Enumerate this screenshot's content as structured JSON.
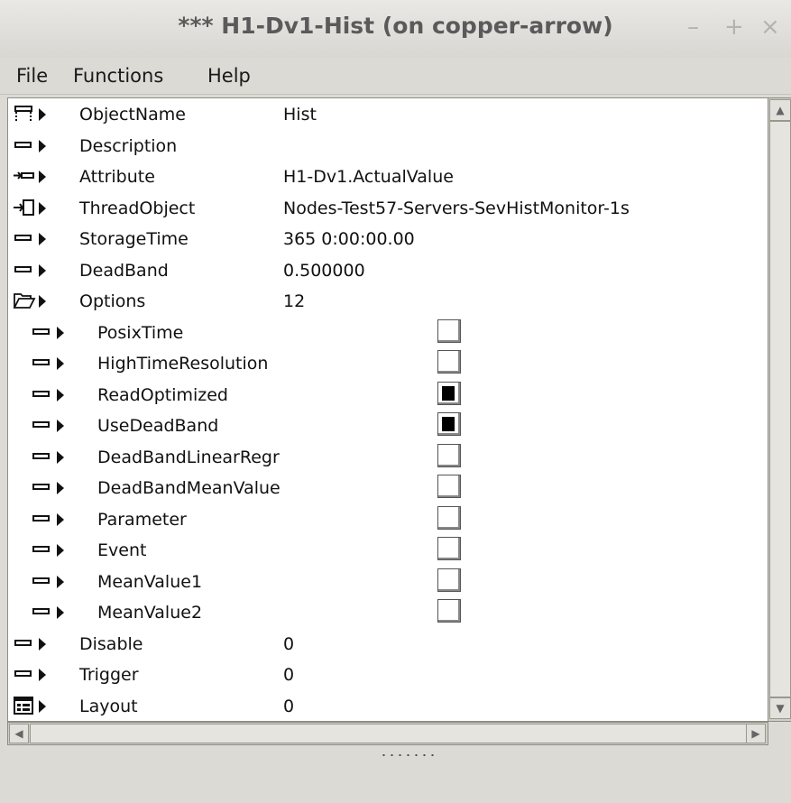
{
  "window": {
    "title": "*** H1-Dv1-Hist (on copper-arrow)",
    "minimize": "–",
    "maximize": "+",
    "close": "×"
  },
  "menu": [
    "File",
    "Functions",
    "Help"
  ],
  "rows": [
    {
      "name": "ObjectName",
      "value": "Hist",
      "icon": "object-icon",
      "indent": 0
    },
    {
      "name": "Description",
      "value": "",
      "icon": "attr-icon",
      "indent": 0
    },
    {
      "name": "Attribute",
      "value": "H1-Dv1.ActualValue",
      "icon": "attrref-icon",
      "indent": 0
    },
    {
      "name": "ThreadObject",
      "value": "Nodes-Test57-Servers-SevHistMonitor-1s",
      "icon": "objref-icon",
      "indent": 0
    },
    {
      "name": "StorageTime",
      "value": "365 0:00:00.00",
      "icon": "attr-icon",
      "indent": 0
    },
    {
      "name": "DeadBand",
      "value": "0.500000",
      "icon": "attr-icon",
      "indent": 0
    },
    {
      "name": "Options",
      "value": "12",
      "icon": "folder-open-icon",
      "indent": 0
    },
    {
      "name": "PosixTime",
      "checked": false,
      "icon": "attr-icon",
      "indent": 1
    },
    {
      "name": "HighTimeResolution",
      "checked": false,
      "icon": "attr-icon",
      "indent": 1
    },
    {
      "name": "ReadOptimized",
      "checked": true,
      "icon": "attr-icon",
      "indent": 1
    },
    {
      "name": "UseDeadBand",
      "checked": true,
      "icon": "attr-icon",
      "indent": 1
    },
    {
      "name": "DeadBandLinearRegr",
      "checked": false,
      "icon": "attr-icon",
      "indent": 1
    },
    {
      "name": "DeadBandMeanValue",
      "checked": false,
      "icon": "attr-icon",
      "indent": 1
    },
    {
      "name": "Parameter",
      "checked": false,
      "icon": "attr-icon",
      "indent": 1
    },
    {
      "name": "Event",
      "checked": false,
      "icon": "attr-icon",
      "indent": 1
    },
    {
      "name": "MeanValue1",
      "checked": false,
      "icon": "attr-icon",
      "indent": 1
    },
    {
      "name": "MeanValue2",
      "checked": false,
      "icon": "attr-icon",
      "indent": 1
    },
    {
      "name": "Disable",
      "value": "0",
      "icon": "attr-icon",
      "indent": 0
    },
    {
      "name": "Trigger",
      "value": "0",
      "icon": "attr-icon",
      "indent": 0
    },
    {
      "name": "Layout",
      "value": "0",
      "icon": "layout-icon",
      "indent": 0
    }
  ]
}
